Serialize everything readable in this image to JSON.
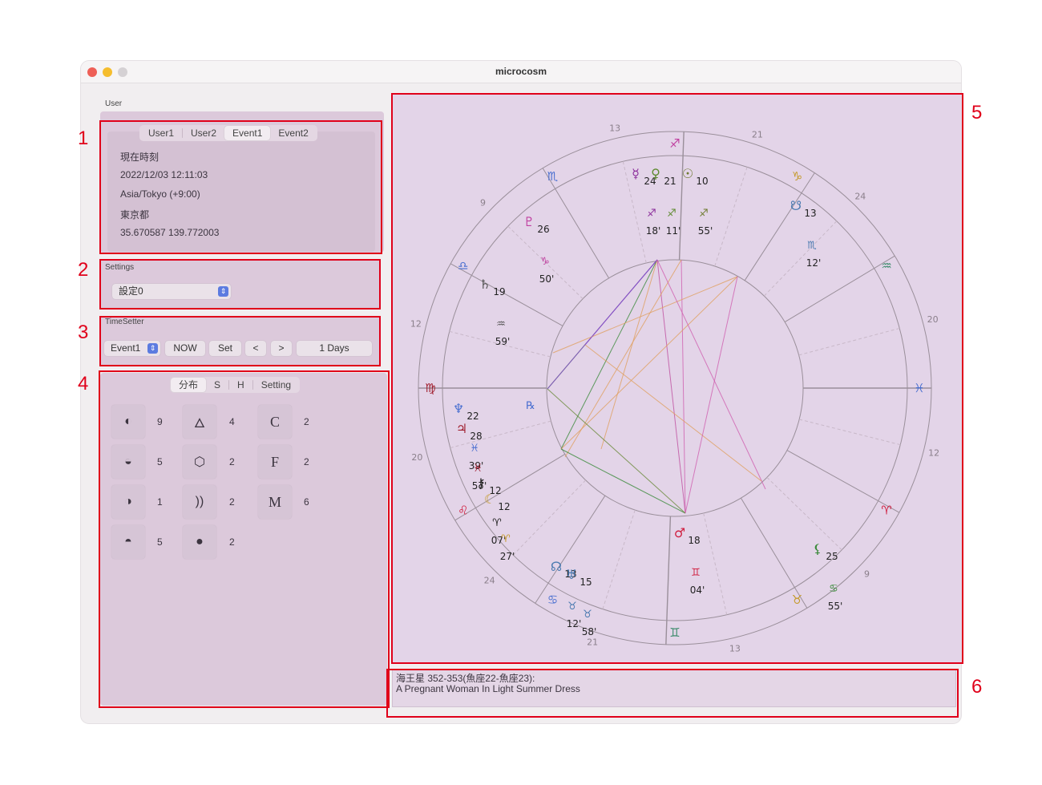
{
  "window": {
    "title": "microcosm"
  },
  "user": {
    "label": "User",
    "tabs": [
      "User1",
      "User2",
      "Event1",
      "Event2"
    ],
    "active_tab": "Event1",
    "name": "現在時刻",
    "datetime": "2022/12/03 12:11:03",
    "timezone": "Asia/Tokyo (+9:00)",
    "place": "東京都",
    "coords": "35.670587 139.772003"
  },
  "settings": {
    "label": "Settings",
    "selected": "設定0"
  },
  "timesetter": {
    "label": "TimeSetter",
    "target": "Event1",
    "now_label": "NOW",
    "set_label": "Set",
    "prev_label": "<",
    "next_label": ">",
    "step": "1 Days"
  },
  "distribution": {
    "tabs": [
      "分布",
      "S",
      "H",
      "Setting"
    ],
    "active_tab": "分布",
    "col1": [
      {
        "icon": "half-left-circle-icon",
        "glyph": "◐",
        "count": "9"
      },
      {
        "icon": "half-bottom-circle-icon",
        "glyph": "◒",
        "count": "5"
      },
      {
        "icon": "half-right-circle-icon",
        "glyph": "◑",
        "count": "1"
      },
      {
        "icon": "half-top-circle-icon",
        "glyph": "◓",
        "count": "5"
      }
    ],
    "col2": [
      {
        "icon": "fire-icon",
        "glyph": "🜂",
        "count": "4"
      },
      {
        "icon": "cube-icon",
        "glyph": "⬡",
        "count": "2"
      },
      {
        "icon": "wind-icon",
        "glyph": "))",
        "count": "2"
      },
      {
        "icon": "drop-icon",
        "glyph": "●",
        "count": "2"
      }
    ],
    "col3": [
      {
        "icon": "cardinal-icon",
        "glyph": "C",
        "count": "2"
      },
      {
        "icon": "fixed-icon",
        "glyph": "F",
        "count": "2"
      },
      {
        "icon": "mutable-icon",
        "glyph": "M",
        "count": "6"
      }
    ]
  },
  "chart": {
    "ring_numbers": [
      "20",
      "24",
      "21",
      "13",
      "9",
      "12",
      "20",
      "24",
      "21",
      "13",
      "9",
      "12"
    ],
    "planets": [
      {
        "glyph": "☿",
        "deg": "24",
        "sign": "♐",
        "min": "18'",
        "color": "#8a2a9a"
      },
      {
        "glyph": "♀",
        "deg": "21",
        "sign": "♐",
        "min": "11'",
        "color": "#5d8a2e"
      },
      {
        "glyph": "☉",
        "deg": "10",
        "sign": "♐",
        "min": "55'",
        "color": "#6d7a2e"
      },
      {
        "glyph": "♇",
        "deg": "26",
        "sign": "♑",
        "min": "50'",
        "color": "#c03fa0"
      },
      {
        "glyph": "♄",
        "deg": "19",
        "sign": "♒",
        "min": "59'",
        "color": "#555"
      },
      {
        "glyph": "♆",
        "deg": "22",
        "sign": "♓",
        "min": "39'",
        "color": "#4a6fd0"
      },
      {
        "glyph": "♃",
        "deg": "28",
        "sign": "♓",
        "min": "57'",
        "color": "#a01f2f"
      },
      {
        "glyph": "⚷",
        "deg": "12",
        "sign": "♈",
        "min": "07'",
        "color": "#222"
      },
      {
        "glyph": "☾",
        "deg": "12",
        "sign": "♈",
        "min": "27'",
        "color": "#c59a2a"
      },
      {
        "glyph": "☊",
        "deg": "13",
        "sign": "♉",
        "min": "12'",
        "color": "#4a7ab0"
      },
      {
        "glyph": "♅",
        "deg": "15",
        "sign": "♉",
        "min": "58'",
        "color": "#4a7ab0"
      },
      {
        "glyph": "♂",
        "deg": "18",
        "sign": "♊",
        "min": "04'",
        "color": "#d02040"
      },
      {
        "glyph": "⚸",
        "deg": "25",
        "sign": "♋",
        "min": "55'",
        "color": "#3a8a3a"
      },
      {
        "glyph": "☋",
        "deg": "13",
        "sign": "♏",
        "min": "12'",
        "color": "#4a7ab0"
      }
    ],
    "signs": [
      {
        "glyph": "♐",
        "color": "#c03fa0"
      },
      {
        "glyph": "♏",
        "color": "#4a6fd0"
      },
      {
        "glyph": "♎",
        "color": "#4a6fd0"
      },
      {
        "glyph": "♍",
        "color": "#a01f2f"
      },
      {
        "glyph": "♌",
        "color": "#d02040"
      },
      {
        "glyph": "♋",
        "color": "#4a6fd0"
      },
      {
        "glyph": "♊",
        "color": "#3a8a6a"
      },
      {
        "glyph": "♉",
        "color": "#c59a2a"
      },
      {
        "glyph": "♈",
        "color": "#d02040"
      },
      {
        "glyph": "♓",
        "color": "#4a6fd0"
      },
      {
        "glyph": "♒",
        "color": "#3a8a6a"
      },
      {
        "glyph": "♑",
        "color": "#c59a2a"
      }
    ],
    "retro_glyph": "℞"
  },
  "message": {
    "line1": "海王星 352-353(魚座22-魚座23):",
    "line2": "A Pregnant Woman In Light Summer Dress"
  },
  "annotations": [
    "1",
    "2",
    "3",
    "4",
    "5",
    "6"
  ]
}
